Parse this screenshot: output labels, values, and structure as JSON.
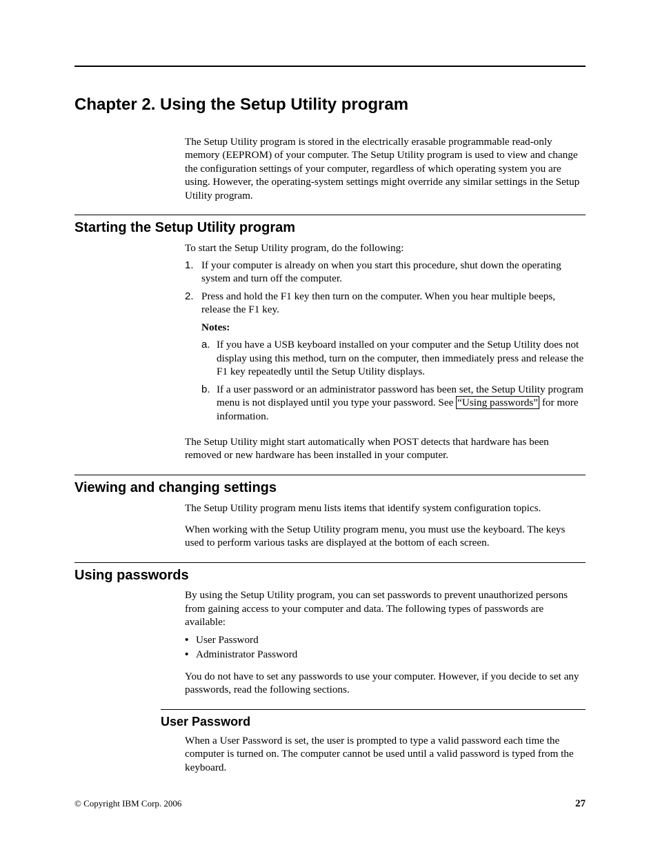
{
  "chapter_title": "Chapter 2. Using the Setup Utility program",
  "intro_para": "The Setup Utility program is stored in the electrically erasable programmable read-only memory (EEPROM) of your computer. The Setup Utility program is used to view and change the configuration settings of your computer, regardless of which operating system you are using. However, the operating-system settings might override any similar settings in the Setup Utility program.",
  "section_starting": {
    "heading": "Starting the Setup Utility program",
    "lead": "To start the Setup Utility program, do the following:",
    "steps": {
      "s1_num": "1.",
      "s1": "If your computer is already on when you start this procedure, shut down the operating system and turn off the computer.",
      "s2_num": "2.",
      "s2": "Press and hold the F1 key then turn on the computer. When you hear multiple beeps, release the F1 key.",
      "notes_label": "Notes:",
      "n_a_num": "a.",
      "n_a": "If you have a USB keyboard installed on your computer and the Setup Utility does not display using this method, turn on the computer, then immediately press and release the F1 key repeatedly until the Setup Utility displays.",
      "n_b_num": "b.",
      "n_b_pre": "If a user password or an administrator password has been set, the Setup Utility program menu is not displayed until you type your password. See ",
      "n_b_link": "“Using passwords”",
      "n_b_post": " for more information."
    },
    "tail": "The Setup Utility might start automatically when POST detects that hardware has been removed or new hardware has been installed in your computer."
  },
  "section_viewing": {
    "heading": "Viewing and changing settings",
    "p1": "The Setup Utility program menu lists items that identify system configuration topics.",
    "p2": "When working with the Setup Utility program menu, you must use the keyboard. The keys used to perform various tasks are displayed at the bottom of each screen."
  },
  "section_passwords": {
    "heading": "Using passwords",
    "p1": "By using the Setup Utility program, you can set passwords to prevent unauthorized persons from gaining access to your computer and data. The following types of passwords are available:",
    "bullets": {
      "b1": "User Password",
      "b2": "Administrator Password"
    },
    "p2": "You do not have to set any passwords to use your computer. However, if you decide to set any passwords, read the following sections.",
    "sub_user": {
      "heading": "User Password",
      "p1": "When a User Password is set, the user is prompted to type a valid password each time the computer is turned on. The computer cannot be used until a valid password is typed from the keyboard."
    }
  },
  "footer": {
    "copyright": "© Copyright IBM Corp. 2006",
    "page": "27"
  }
}
